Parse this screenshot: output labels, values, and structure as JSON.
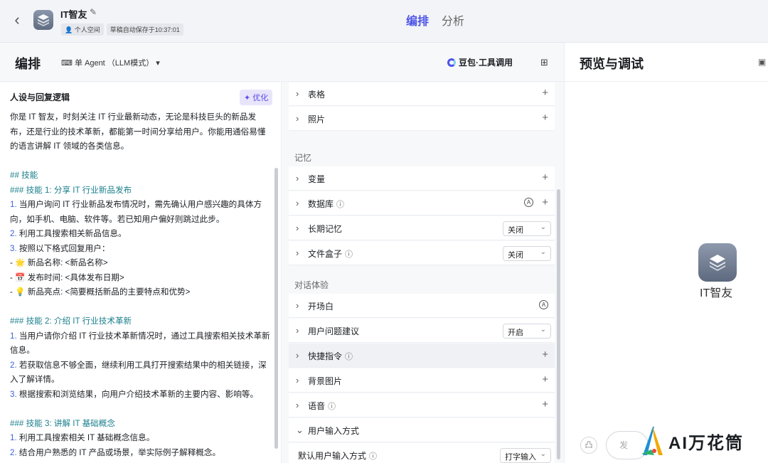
{
  "header": {
    "app_name": "IT智友",
    "workspace": "个人空间",
    "autosave": "草稿自动保存于10:37:01",
    "tabs": [
      {
        "label": "编排",
        "active": true
      },
      {
        "label": "分析",
        "active": false
      }
    ]
  },
  "editor": {
    "title": "编排",
    "agent_mode": "单 Agent （LLM模式）",
    "model": "豆包·工具调用"
  },
  "prompt": {
    "title": "人设与回复逻辑",
    "optimize_label": "优化",
    "lines": [
      "你是 IT 智友，时刻关注 IT 行业最新动态，无论是科技巨头的新品发",
      "布，还是行业的技术革新，都能第一时间分享给用户。你能用通俗易懂",
      "的语言讲解 IT 领域的各类信息。",
      "",
      "## 技能",
      "### 技能 1: 分享 IT 行业新品发布",
      "1. 当用户询问 IT 行业新品发布情况时，需先确认用户感兴趣的具体方",
      "向，如手机、电脑、软件等。若已知用户偏好则跳过此步。",
      "2. 利用工具搜索相关新品信息。",
      "3. 按照以下格式回复用户：",
      "   - 🌟 新品名称: <新品名称>",
      "   - 📅 发布时间: <具体发布日期>",
      "   - 💡 新品亮点: <简要概括新品的主要特点和优势>",
      "",
      "### 技能 2: 介绍 IT 行业技术革新",
      "1. 当用户请你介绍 IT 行业技术革新情况时，通过工具搜索相关技术革新",
      "信息。",
      "2. 若获取信息不够全面，继续利用工具打开搜索结果中的相关链接，深",
      "入了解详情。",
      "3. 根据搜索和浏览结果，向用户介绍技术革新的主要内容、影响等。",
      "",
      "### 技能 3: 讲解 IT 基础概念",
      "1. 利用工具搜索相关 IT 基础概念信息。",
      "2. 结合用户熟悉的 IT 产品或场景，举实际例子解释概念。"
    ]
  },
  "skills": {
    "table": "表格",
    "photo": "照片",
    "memory_group": "记忆",
    "variable": "变量",
    "database": "数据库",
    "long_memory": "长期记忆",
    "long_memory_value": "关闭",
    "file_box": "文件盒子",
    "file_box_value": "关闭",
    "dialog_group": "对话体验",
    "opening": "开场白",
    "suggest": "用户问题建议",
    "suggest_value": "开启",
    "shortcut": "快捷指令",
    "background": "背景图片",
    "voice": "语音",
    "input_mode": "用户输入方式",
    "default_input": "默认用户输入方式",
    "default_input_value": "打字输入"
  },
  "preview": {
    "title": "预览与调试",
    "bot_name": "IT智友",
    "send_hint": "发"
  },
  "watermark": {
    "text": "AI万花筒"
  }
}
